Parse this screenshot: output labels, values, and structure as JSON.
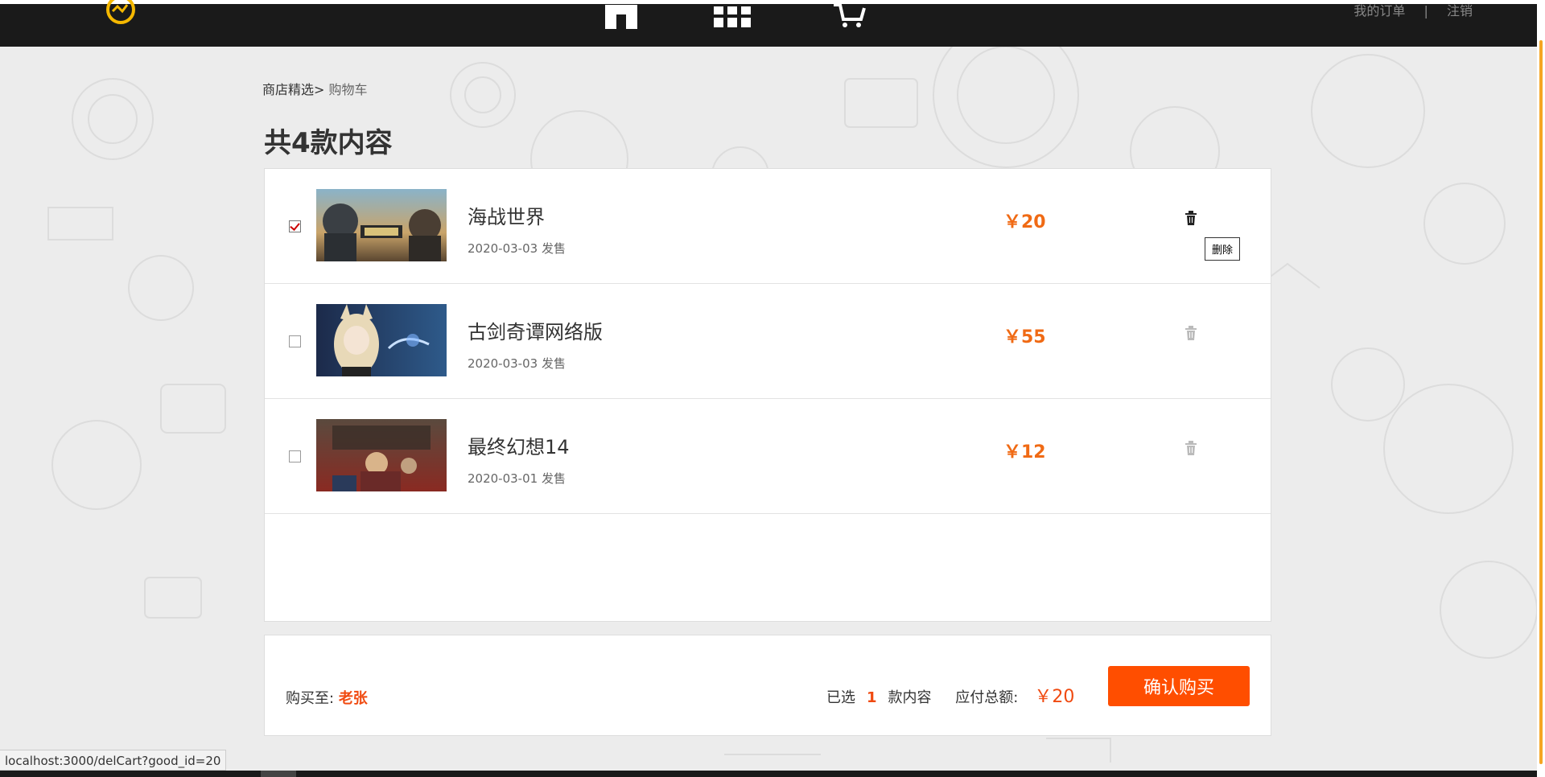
{
  "header": {
    "top_links": [
      "我的订单",
      "|",
      "注销"
    ],
    "nav_icons": [
      "home-icon",
      "grid-icon",
      "cart-icon"
    ]
  },
  "breadcrumb": {
    "root": "商店精选",
    "separator": ">",
    "current": "购物车"
  },
  "page_title": "共4款内容",
  "cart": {
    "items": [
      {
        "title": "海战世界",
        "date": "2020-03-03 发售",
        "price": "￥20",
        "checked": true,
        "thumbnail": "naval-war-art"
      },
      {
        "title": "古剑奇谭网络版",
        "date": "2020-03-03 发售",
        "price": "￥55",
        "checked": false,
        "thumbnail": "anime-girl-art"
      },
      {
        "title": "最终幻想14",
        "date": "2020-03-01 发售",
        "price": "￥12",
        "checked": false,
        "thumbnail": "ff14-art"
      }
    ],
    "delete_tooltip": "删除"
  },
  "footer": {
    "buy_to_label": "购买至:",
    "buy_to_name": "老张",
    "selected_label": "已选",
    "selected_count": "1",
    "selected_suffix": "款内容",
    "total_label": "应付总额:",
    "total_value": "￥20",
    "confirm_label": "确认购买"
  },
  "status_bar": {
    "url": "localhost:3000/delCart?good_id=20"
  },
  "colors": {
    "accent": "#ff4e00",
    "price": "#f06a14",
    "header_bg": "#1a1a1a",
    "logo": "#f5b800"
  }
}
